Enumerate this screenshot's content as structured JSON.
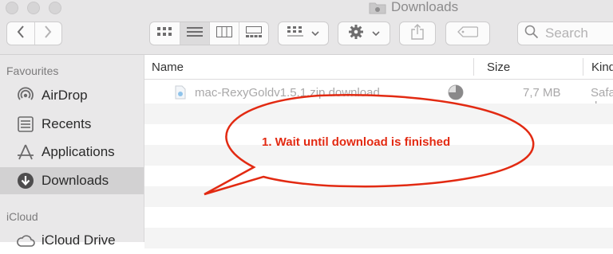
{
  "window": {
    "title": "Downloads"
  },
  "toolbar": {
    "back_icon": "chevron-left-icon",
    "forward_icon": "chevron-right-icon",
    "views": [
      "icon-view-icon",
      "list-view-icon",
      "column-view-icon",
      "gallery-view-icon"
    ],
    "active_view": "list-view-icon",
    "search_placeholder": "Search"
  },
  "sidebar": {
    "favourites_header": "Favourites",
    "items": [
      {
        "label": "AirDrop",
        "icon": "airdrop-icon"
      },
      {
        "label": "Recents",
        "icon": "recents-icon"
      },
      {
        "label": "Applications",
        "icon": "applications-icon"
      },
      {
        "label": "Downloads",
        "icon": "downloads-icon",
        "selected": true
      }
    ],
    "icloud_header": "iCloud",
    "icloud_items": [
      {
        "label": "iCloud Drive",
        "icon": "cloud-icon"
      }
    ]
  },
  "list": {
    "columns": [
      "Name",
      "Size",
      "Kind"
    ],
    "rows": [
      {
        "name": "mac-RexyGoldv1.5.1.zip.download",
        "progress": 0.75,
        "size": "7,7 MB",
        "kind": "Safari download"
      }
    ]
  },
  "annotation": {
    "text": "1. Wait until download is finished",
    "color": "#e22a12"
  },
  "colors": {
    "sidebar_bg": "#e9e8e9",
    "selected_bg": "#d2d1d2",
    "annotation_red": "#e22a12"
  }
}
